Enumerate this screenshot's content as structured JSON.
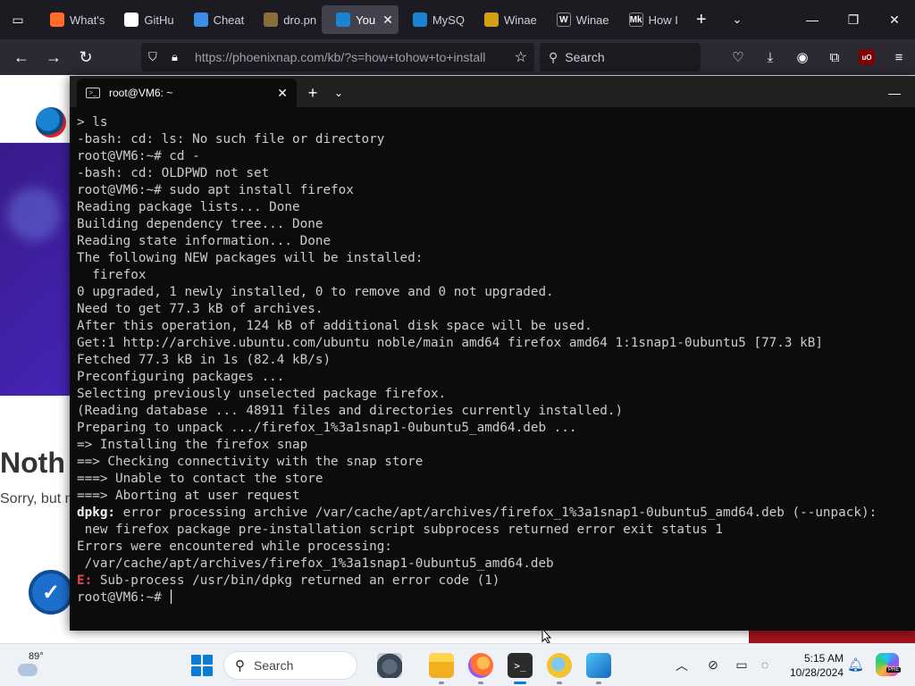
{
  "browser": {
    "tabs": [
      {
        "label": "What's",
        "favicon_color": "#ff6b2b",
        "favicon": "firefox-icon"
      },
      {
        "label": "GitHu",
        "favicon_color": "#ffffff",
        "favicon": "github-icon"
      },
      {
        "label": "Cheat",
        "favicon_color": "#3b8ee8",
        "favicon": "vscode-icon"
      },
      {
        "label": "dro.pn",
        "favicon_color": "#8a6d3b",
        "favicon": "image-file-icon"
      },
      {
        "label": "You",
        "favicon_color": "#1b84d2",
        "favicon": "phoenixnap-icon",
        "active": true
      },
      {
        "label": "MySQ",
        "favicon_color": "#1b84d2",
        "favicon": "phoenixnap-icon"
      },
      {
        "label": "Winae",
        "favicon_color": "#d4a017",
        "favicon": "winaero-icon"
      },
      {
        "label": "Winae",
        "favicon_color": "#ffffff",
        "favicon": "wikipedia-icon",
        "favicon_text": "W"
      },
      {
        "label": "How I",
        "favicon_color": "#444444",
        "favicon": "medium-icon",
        "favicon_text": "Mk"
      }
    ],
    "url": "https://phoenixnap.com/kb/?s=how+tohow+to+install",
    "search_placeholder": "Search"
  },
  "webpage": {
    "heading": "Noth",
    "subtext": "Sorry, but n"
  },
  "terminal": {
    "tab_title": "root@VM6: ~",
    "lines": [
      {
        "text": "> ls"
      },
      {
        "text": "-bash: cd: ls: No such file or directory"
      },
      {
        "text": "root@VM6:~# cd -"
      },
      {
        "text": "-bash: cd: OLDPWD not set"
      },
      {
        "text": "root@VM6:~# sudo apt install firefox"
      },
      {
        "text": "Reading package lists... Done"
      },
      {
        "text": "Building dependency tree... Done"
      },
      {
        "text": "Reading state information... Done"
      },
      {
        "text": "The following NEW packages will be installed:"
      },
      {
        "text": "  firefox"
      },
      {
        "text": "0 upgraded, 1 newly installed, 0 to remove and 0 not upgraded."
      },
      {
        "text": "Need to get 77.3 kB of archives."
      },
      {
        "text": "After this operation, 124 kB of additional disk space will be used."
      },
      {
        "text": "Get:1 http://archive.ubuntu.com/ubuntu noble/main amd64 firefox amd64 1:1snap1-0ubuntu5 [77.3 kB]"
      },
      {
        "text": "Fetched 77.3 kB in 1s (82.4 kB/s)"
      },
      {
        "text": "Preconfiguring packages ..."
      },
      {
        "text": "Selecting previously unselected package firefox."
      },
      {
        "text": "(Reading database ... 48911 files and directories currently installed.)"
      },
      {
        "text": "Preparing to unpack .../firefox_1%3a1snap1-0ubuntu5_amd64.deb ..."
      },
      {
        "text": "=> Installing the firefox snap"
      },
      {
        "text": "==> Checking connectivity with the snap store"
      },
      {
        "text": "===> Unable to contact the store"
      },
      {
        "text": "===> Aborting at user request"
      },
      {
        "prefix": "dpkg:",
        "prefix_style": "bold",
        "text": " error processing archive /var/cache/apt/archives/firefox_1%3a1snap1-0ubuntu5_amd64.deb (--unpack):"
      },
      {
        "text": " new firefox package pre-installation script subprocess returned error exit status 1"
      },
      {
        "text": "Errors were encountered while processing:"
      },
      {
        "text": " /var/cache/apt/archives/firefox_1%3a1snap1-0ubuntu5_amd64.deb"
      },
      {
        "prefix": "E:",
        "prefix_style": "err",
        "text": " Sub-process /usr/bin/dpkg returned an error code (1)"
      },
      {
        "text": "root@VM6:~# ",
        "cursor": true
      }
    ]
  },
  "taskbar": {
    "weather_temp": "89°",
    "search_label": "Search",
    "time": "5:15 AM",
    "date": "10/28/2024"
  },
  "colors": {
    "terminal_bg": "#0c0c0c",
    "terminal_fg": "#cccccc",
    "error_red": "#e74856",
    "firefox_dark": "#1c1b22",
    "accent_blue": "#0a7cd6"
  }
}
